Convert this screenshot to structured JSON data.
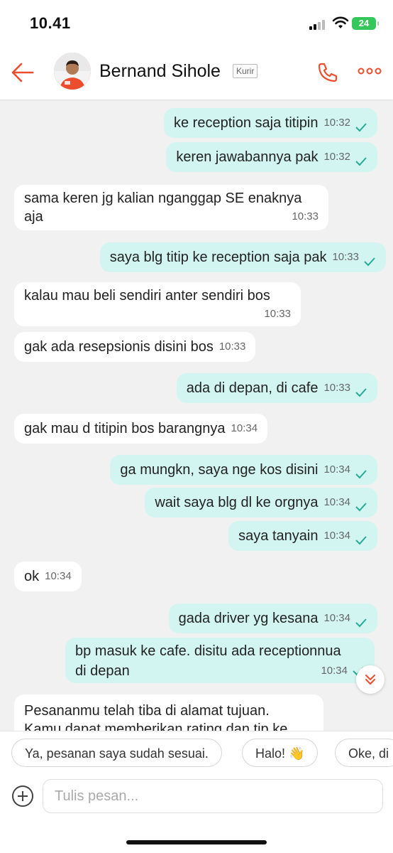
{
  "status": {
    "time": "10.41",
    "battery": "24"
  },
  "header": {
    "contact_name": "Bernand Sihole",
    "role_badge": "Kurir"
  },
  "messages": [
    {
      "dir": "out",
      "text": "ke reception saja titipin",
      "time": "10:32",
      "read": true
    },
    {
      "dir": "out",
      "text": "keren jawabannya pak",
      "time": "10:32",
      "read": true
    },
    {
      "dir": "in",
      "text": "sama keren jg kalian nganggap SE enaknya",
      "text2": "aja",
      "time": "10:33"
    },
    {
      "dir": "out",
      "text": "saya blg titip ke reception saja pak",
      "time": "10:33",
      "read": true
    },
    {
      "dir": "in",
      "text": "kalau mau beli sendiri anter sendiri bos",
      "time": "10:33"
    },
    {
      "dir": "in",
      "text": "gak ada resepsionis disini bos",
      "time": "10:33"
    },
    {
      "dir": "out",
      "text": "ada di depan, di cafe",
      "time": "10:33",
      "read": true
    },
    {
      "dir": "in",
      "text": "gak mau d titipin bos barangnya",
      "time": "10:34"
    },
    {
      "dir": "out",
      "text": "ga mungkn, saya nge kos disini",
      "time": "10:34",
      "read": true
    },
    {
      "dir": "out",
      "text": "wait saya blg dl ke orgnya",
      "time": "10:34",
      "read": true
    },
    {
      "dir": "out",
      "text": "saya tanyain",
      "time": "10:34",
      "read": true
    },
    {
      "dir": "in",
      "text": "ok",
      "time": "10:34"
    },
    {
      "dir": "out",
      "text": "gada driver yg kesana",
      "time": "10:34",
      "read": true
    },
    {
      "dir": "out",
      "text": "bp masuk ke cafe. disitu ada receptionnua",
      "text2": "di depan",
      "time": "10:34",
      "read": true
    },
    {
      "dir": "in",
      "text": "Pesananmu telah tiba di alamat tujuan.",
      "text2": "Kamu dapat memberikan rating dan tip ke"
    }
  ],
  "quick_replies": [
    "Ya, pesanan saya sudah sesuai.",
    "Halo! 👋",
    "Oke, di"
  ],
  "composer": {
    "placeholder": "Tulis pesan..."
  },
  "colors": {
    "accent": "#ee4d2d",
    "outgoing_bubble": "#d3f5f2",
    "incoming_bubble": "#ffffff",
    "check": "#26aa99"
  }
}
